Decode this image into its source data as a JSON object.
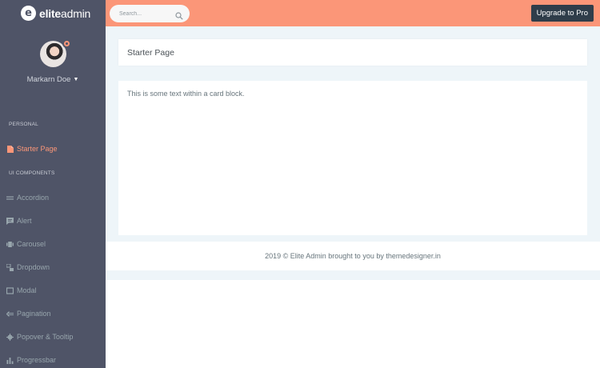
{
  "brand": {
    "logo_letter": "e",
    "name_bold": "elite",
    "name_light": "admin"
  },
  "search": {
    "placeholder": "Search..."
  },
  "topbar": {
    "upgrade_label": "Upgrade to Pro"
  },
  "profile": {
    "name": "Markarn Doe",
    "caret": "▼"
  },
  "sidebar": {
    "sections": [
      {
        "heading": "PERSONAL"
      },
      {
        "heading": "UI COMPONENTS"
      }
    ],
    "items": [
      {
        "label": "Starter Page",
        "icon": "file-icon",
        "active": true
      },
      {
        "label": "Accordion",
        "icon": "equals-icon"
      },
      {
        "label": "Alert",
        "icon": "message-icon"
      },
      {
        "label": "Carousel",
        "icon": "carousel-icon"
      },
      {
        "label": "Dropdown",
        "icon": "dropdown-icon"
      },
      {
        "label": "Modal",
        "icon": "window-icon"
      },
      {
        "label": "Pagination",
        "icon": "arrow-left-icon"
      },
      {
        "label": "Popover & Tooltip",
        "icon": "gear-icon"
      },
      {
        "label": "Progressbar",
        "icon": "bar-chart-icon"
      }
    ]
  },
  "page": {
    "title": "Starter Page",
    "card_text": "This is some text within a card block."
  },
  "footer": {
    "text": "2019 © Elite Admin brought to you by themedesigner.in"
  },
  "colors": {
    "topbar": "#fb9678",
    "sidebar": "#4f5467",
    "active": "#fb9678",
    "upgrade_button": "#2f3d4a",
    "page_background": "#eef5f9"
  }
}
